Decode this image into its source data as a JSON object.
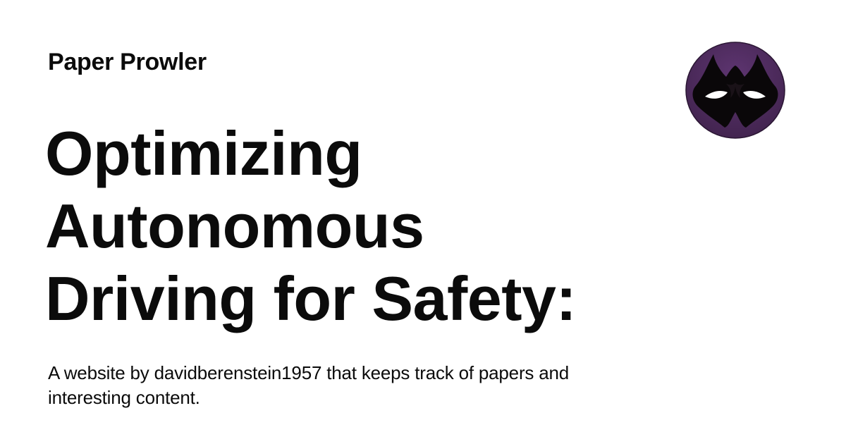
{
  "site": {
    "name": "Paper Prowler"
  },
  "post": {
    "title": "Optimizing Autonomous Driving for Safety:",
    "description": "A website by davidberenstein1957 that keeps track of papers and interesting content."
  },
  "avatar": {
    "icon": "masked-face-icon",
    "background_color": "#4e2b5f",
    "border_color": "#2a1633"
  }
}
